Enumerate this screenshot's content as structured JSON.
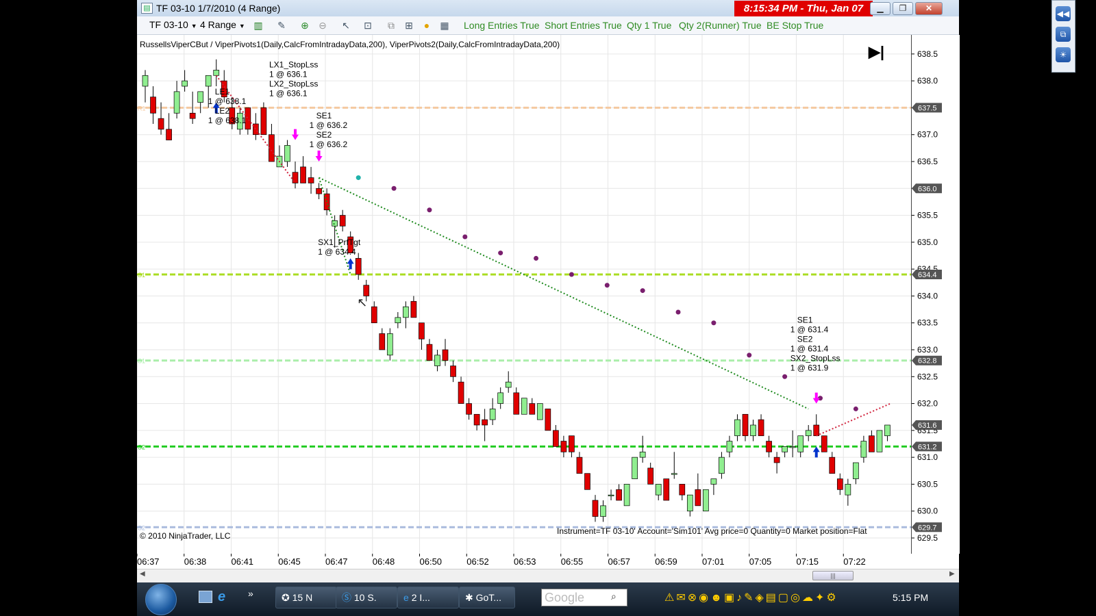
{
  "window": {
    "title": "TF 03-10  1/7/2010 (4 Range)",
    "clock": "8:15:34 PM - Thu, Jan 07",
    "minimize": "▁",
    "restore": "❐",
    "close": "✕"
  },
  "toolbar": {
    "instrument": "TF 03-10",
    "interval": "4 Range",
    "strategy_params": [
      "Long Entries True",
      "Short Entries True",
      "Qty 1 True",
      "Qty 2(Runner) True",
      "BE Stop True"
    ],
    "icons": [
      "bar-type-icon",
      "drawing-tool-icon",
      "zoom-in-icon",
      "zoom-out-icon",
      "cursor-icon",
      "data-box-icon",
      "indicators-icon",
      "strategies-icon",
      "currency-icon",
      "properties-icon"
    ]
  },
  "chart": {
    "indicator_label": "RussellsViperCBut / ViperPivots1(Daily,CalcFromIntradayData,200), ViperPivots2(Daily,CalcFromIntradayData,200)",
    "copyright": "© 2010 NinjaTrader, LLC",
    "status_line": "Instrument=TF 03-10' Account='Sim101' Avg price=0 Quantity=0 Market position=Flat",
    "play_button": "▶|",
    "up_color": "#90ee90",
    "down_color": "#e00000",
    "y_ticks": [
      "638.5",
      "638.0",
      "637.5",
      "637.0",
      "636.5",
      "636.0",
      "635.5",
      "635.0",
      "634.5",
      "634.0",
      "633.5",
      "633.0",
      "632.5",
      "632.0",
      "631.5",
      "631.0",
      "630.5",
      "630.0",
      "629.5"
    ],
    "price_boxes": [
      "637.5",
      "636.0",
      "634.4",
      "632.8",
      "631.6",
      "631.2",
      "629.7"
    ],
    "x_ticks": [
      "06:37",
      "06:38",
      "06:41",
      "06:45",
      "06:47",
      "06:48",
      "06:50",
      "06:52",
      "06:53",
      "06:55",
      "06:57",
      "06:59",
      "07:01",
      "07:05",
      "07:15",
      "07:22"
    ],
    "pivot_line_labels": [
      "R1",
      "S1",
      "S1",
      "S2",
      "S2"
    ],
    "annotations": [
      {
        "lines": [
          "LE1",
          "1 @ 638.1",
          "LE2",
          "1 @ 638.1"
        ]
      },
      {
        "lines": [
          "LX1_StopLss",
          "1 @ 636.1",
          "LX2_StopLss",
          "1 @ 636.1"
        ]
      },
      {
        "lines": [
          "SE1",
          "1 @ 636.2",
          "SE2",
          "1 @ 636.2"
        ]
      },
      {
        "lines": [
          "SX1_PrfTgt",
          "1 @ 634.4"
        ]
      },
      {
        "lines": [
          "SE1",
          "1 @ 631.4",
          "SE2",
          "1 @ 631.4",
          "SX2_StopLss",
          "1 @ 631.9"
        ]
      }
    ]
  },
  "chart_data": {
    "type": "candlestick",
    "ylim": [
      629.5,
      638.6
    ],
    "candles": [
      {
        "o": 637.9,
        "h": 638.2,
        "l": 637.6,
        "c": 638.1
      },
      {
        "o": 637.7,
        "h": 637.9,
        "l": 637.2,
        "c": 637.4
      },
      {
        "o": 637.3,
        "h": 637.6,
        "l": 637.0,
        "c": 637.1
      },
      {
        "o": 637.1,
        "h": 637.4,
        "l": 636.9,
        "c": 636.9
      },
      {
        "o": 637.4,
        "h": 638.0,
        "l": 637.3,
        "c": 637.8
      },
      {
        "o": 637.9,
        "h": 638.2,
        "l": 637.8,
        "c": 638.0
      },
      {
        "o": 637.4,
        "h": 637.8,
        "l": 637.2,
        "c": 637.3
      },
      {
        "o": 637.6,
        "h": 637.8,
        "l": 637.4,
        "c": 637.8
      },
      {
        "o": 637.9,
        "h": 638.1,
        "l": 637.5,
        "c": 638.1
      },
      {
        "o": 638.1,
        "h": 638.4,
        "l": 637.9,
        "c": 638.2
      },
      {
        "o": 638.0,
        "h": 638.2,
        "l": 637.6,
        "c": 637.7
      },
      {
        "o": 637.5,
        "h": 637.7,
        "l": 637.1,
        "c": 637.2
      },
      {
        "o": 637.1,
        "h": 637.5,
        "l": 637.0,
        "c": 637.4
      },
      {
        "o": 637.5,
        "h": 637.5,
        "l": 637.0,
        "c": 637.1
      },
      {
        "o": 637.2,
        "h": 637.4,
        "l": 636.9,
        "c": 637.0
      },
      {
        "o": 637.5,
        "h": 637.6,
        "l": 637.0,
        "c": 637.0
      },
      {
        "o": 637.0,
        "h": 637.2,
        "l": 636.5,
        "c": 636.5
      },
      {
        "o": 636.4,
        "h": 636.8,
        "l": 636.4,
        "c": 636.6
      },
      {
        "o": 636.5,
        "h": 636.9,
        "l": 636.4,
        "c": 636.8
      },
      {
        "o": 636.3,
        "h": 636.5,
        "l": 636.0,
        "c": 636.1
      },
      {
        "o": 636.4,
        "h": 636.6,
        "l": 636.1,
        "c": 636.1
      },
      {
        "o": 636.2,
        "h": 636.4,
        "l": 635.9,
        "c": 636.1
      },
      {
        "o": 636.0,
        "h": 636.1,
        "l": 635.8,
        "c": 635.9
      },
      {
        "o": 635.9,
        "h": 636.0,
        "l": 635.5,
        "c": 635.6
      },
      {
        "o": 635.3,
        "h": 635.5,
        "l": 634.9,
        "c": 635.4
      },
      {
        "o": 635.5,
        "h": 635.6,
        "l": 635.2,
        "c": 635.3
      },
      {
        "o": 635.1,
        "h": 635.2,
        "l": 634.8,
        "c": 634.8
      },
      {
        "o": 634.7,
        "h": 634.8,
        "l": 634.3,
        "c": 634.4
      },
      {
        "o": 634.2,
        "h": 634.3,
        "l": 633.9,
        "c": 634.0
      },
      {
        "o": 633.8,
        "h": 633.9,
        "l": 633.5,
        "c": 633.5
      },
      {
        "o": 633.3,
        "h": 633.4,
        "l": 633.0,
        "c": 633.0
      },
      {
        "o": 632.9,
        "h": 633.4,
        "l": 632.8,
        "c": 633.3
      },
      {
        "o": 633.5,
        "h": 633.7,
        "l": 633.4,
        "c": 633.6
      },
      {
        "o": 633.6,
        "h": 633.9,
        "l": 633.4,
        "c": 633.8
      },
      {
        "o": 633.9,
        "h": 634.0,
        "l": 633.6,
        "c": 633.6
      },
      {
        "o": 633.5,
        "h": 633.5,
        "l": 633.0,
        "c": 633.2
      },
      {
        "o": 633.1,
        "h": 633.2,
        "l": 632.8,
        "c": 632.8
      },
      {
        "o": 632.7,
        "h": 633.0,
        "l": 632.6,
        "c": 632.9
      },
      {
        "o": 633.0,
        "h": 633.2,
        "l": 632.7,
        "c": 632.8
      },
      {
        "o": 632.7,
        "h": 632.8,
        "l": 632.4,
        "c": 632.5
      },
      {
        "o": 632.4,
        "h": 632.5,
        "l": 632.0,
        "c": 632.0
      },
      {
        "o": 632.0,
        "h": 632.1,
        "l": 631.7,
        "c": 631.8
      },
      {
        "o": 631.8,
        "h": 631.8,
        "l": 631.5,
        "c": 631.6
      },
      {
        "o": 631.7,
        "h": 631.9,
        "l": 631.3,
        "c": 631.6
      },
      {
        "o": 631.7,
        "h": 632.1,
        "l": 631.6,
        "c": 631.9
      },
      {
        "o": 632.0,
        "h": 632.3,
        "l": 631.9,
        "c": 632.2
      },
      {
        "o": 632.3,
        "h": 632.6,
        "l": 632.2,
        "c": 632.4
      },
      {
        "o": 632.2,
        "h": 632.3,
        "l": 631.8,
        "c": 631.8
      },
      {
        "o": 631.8,
        "h": 632.1,
        "l": 631.8,
        "c": 632.1
      },
      {
        "o": 632.0,
        "h": 632.1,
        "l": 631.8,
        "c": 631.8
      },
      {
        "o": 631.7,
        "h": 632.0,
        "l": 631.7,
        "c": 632.0
      },
      {
        "o": 631.9,
        "h": 631.9,
        "l": 631.5,
        "c": 631.5
      },
      {
        "o": 631.5,
        "h": 631.6,
        "l": 631.2,
        "c": 631.2
      },
      {
        "o": 631.3,
        "h": 631.4,
        "l": 631.0,
        "c": 631.1
      },
      {
        "o": 631.4,
        "h": 631.4,
        "l": 631.0,
        "c": 631.1
      },
      {
        "o": 631.0,
        "h": 631.1,
        "l": 630.7,
        "c": 630.7
      },
      {
        "o": 630.7,
        "h": 630.7,
        "l": 630.4,
        "c": 630.4
      },
      {
        "o": 630.2,
        "h": 630.3,
        "l": 629.8,
        "c": 629.9
      },
      {
        "o": 629.9,
        "h": 630.2,
        "l": 629.8,
        "c": 630.1
      },
      {
        "o": 630.3,
        "h": 630.4,
        "l": 630.2,
        "c": 630.3
      },
      {
        "o": 630.4,
        "h": 630.5,
        "l": 630.2,
        "c": 630.2
      },
      {
        "o": 630.1,
        "h": 630.5,
        "l": 630.1,
        "c": 630.5
      },
      {
        "o": 630.6,
        "h": 631.0,
        "l": 630.6,
        "c": 631.0
      },
      {
        "o": 631.0,
        "h": 631.4,
        "l": 630.9,
        "c": 631.1
      },
      {
        "o": 630.8,
        "h": 630.9,
        "l": 630.5,
        "c": 630.5
      },
      {
        "o": 630.3,
        "h": 630.5,
        "l": 630.2,
        "c": 630.5
      },
      {
        "o": 630.6,
        "h": 630.6,
        "l": 630.2,
        "c": 630.2
      },
      {
        "o": 630.7,
        "h": 631.1,
        "l": 630.6,
        "c": 630.7
      },
      {
        "o": 630.5,
        "h": 630.5,
        "l": 630.2,
        "c": 630.3
      },
      {
        "o": 630.0,
        "h": 630.3,
        "l": 629.9,
        "c": 630.3
      },
      {
        "o": 630.4,
        "h": 630.7,
        "l": 630.1,
        "c": 630.1
      },
      {
        "o": 630.0,
        "h": 630.4,
        "l": 630.0,
        "c": 630.4
      },
      {
        "o": 630.5,
        "h": 630.6,
        "l": 630.3,
        "c": 630.6
      },
      {
        "o": 630.7,
        "h": 631.1,
        "l": 630.6,
        "c": 631.0
      },
      {
        "o": 631.1,
        "h": 631.4,
        "l": 631.0,
        "c": 631.3
      },
      {
        "o": 631.4,
        "h": 631.8,
        "l": 631.3,
        "c": 631.7
      },
      {
        "o": 631.8,
        "h": 631.8,
        "l": 631.3,
        "c": 631.4
      },
      {
        "o": 631.4,
        "h": 631.7,
        "l": 631.3,
        "c": 631.6
      },
      {
        "o": 631.7,
        "h": 631.8,
        "l": 631.4,
        "c": 631.4
      },
      {
        "o": 631.3,
        "h": 631.4,
        "l": 631.0,
        "c": 631.1
      },
      {
        "o": 631.0,
        "h": 631.1,
        "l": 630.7,
        "c": 630.9
      },
      {
        "o": 631.1,
        "h": 631.2,
        "l": 631.0,
        "c": 631.2
      },
      {
        "o": 631.2,
        "h": 631.5,
        "l": 631.0,
        "c": 631.2
      },
      {
        "o": 631.1,
        "h": 631.4,
        "l": 631.0,
        "c": 631.4
      },
      {
        "o": 631.4,
        "h": 631.6,
        "l": 631.3,
        "c": 631.5
      },
      {
        "o": 631.6,
        "h": 631.8,
        "l": 631.4,
        "c": 631.4
      },
      {
        "o": 631.4,
        "h": 631.4,
        "l": 631.1,
        "c": 631.1
      },
      {
        "o": 631.0,
        "h": 631.1,
        "l": 630.7,
        "c": 630.7
      },
      {
        "o": 630.6,
        "h": 630.7,
        "l": 630.3,
        "c": 630.4
      },
      {
        "o": 630.3,
        "h": 630.6,
        "l": 630.1,
        "c": 630.5
      },
      {
        "o": 630.6,
        "h": 630.9,
        "l": 630.5,
        "c": 630.9
      },
      {
        "o": 631.0,
        "h": 631.4,
        "l": 630.9,
        "c": 631.3
      },
      {
        "o": 631.4,
        "h": 631.5,
        "l": 631.1,
        "c": 631.1
      },
      {
        "o": 631.1,
        "h": 631.5,
        "l": 631.1,
        "c": 631.5
      },
      {
        "o": 631.4,
        "h": 631.6,
        "l": 631.3,
        "c": 631.6
      }
    ],
    "pivot_lines": [
      {
        "value": 637.5,
        "color": "#f5c9a0",
        "style": "dashed"
      },
      {
        "value": 634.4,
        "color": "#aadd22",
        "style": "dashed"
      },
      {
        "value": 632.8,
        "color": "#aaeeaa",
        "style": "dashed"
      },
      {
        "value": 631.2,
        "color": "#22cc22",
        "style": "dashed"
      },
      {
        "value": 629.7,
        "color": "#aabbdd",
        "style": "dashed"
      }
    ],
    "dots": [
      636.2,
      636.0,
      635.6,
      635.1,
      634.8,
      634.7,
      634.4,
      634.2,
      634.1,
      633.7,
      633.5,
      632.9,
      632.5,
      632.1,
      631.9
    ]
  },
  "taskbar": {
    "tasks": [
      "15 N",
      "10 S.",
      "2 I...",
      "GoT..."
    ],
    "search_placeholder": "Google",
    "time": "5:15 PM"
  },
  "side_panel": {
    "buttons": [
      "◀◀",
      "⧉",
      "☀"
    ]
  }
}
